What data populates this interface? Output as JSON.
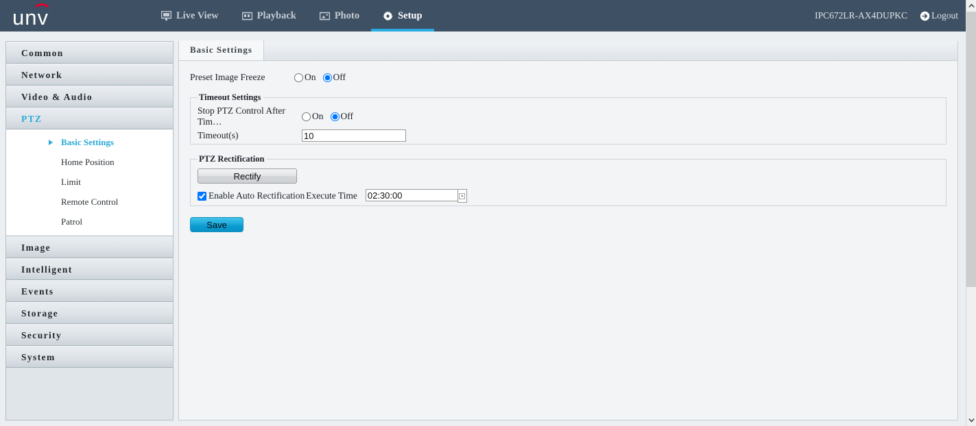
{
  "header": {
    "logo_text": "unv",
    "logo_arc_color": "#e4002b",
    "background_color": "#3e5063",
    "accent_color": "#29abe2",
    "nav": [
      {
        "label": "Live View",
        "icon": "monitor-icon",
        "active": false
      },
      {
        "label": "Playback",
        "icon": "film-icon",
        "active": false
      },
      {
        "label": "Photo",
        "icon": "image-icon",
        "active": false
      },
      {
        "label": "Setup",
        "icon": "gear-icon",
        "active": true
      }
    ],
    "device_name": "IPC672LR-AX4DUPKC",
    "logout_label": "Logout",
    "logout_icon": "logout-arrow-icon"
  },
  "sidebar": {
    "groups": [
      {
        "label": "Common",
        "active": false
      },
      {
        "label": "Network",
        "active": false
      },
      {
        "label": "Video & Audio",
        "active": false
      },
      {
        "label": "PTZ",
        "active": true
      },
      {
        "label": "Image",
        "active": false
      },
      {
        "label": "Intelligent",
        "active": false
      },
      {
        "label": "Events",
        "active": false
      },
      {
        "label": "Storage",
        "active": false
      },
      {
        "label": "Security",
        "active": false
      },
      {
        "label": "System",
        "active": false
      }
    ],
    "ptz_subitems": [
      {
        "label": "Basic Settings",
        "active": true
      },
      {
        "label": "Home Position",
        "active": false
      },
      {
        "label": "Limit",
        "active": false
      },
      {
        "label": "Remote Control",
        "active": false
      },
      {
        "label": "Patrol",
        "active": false
      }
    ],
    "active_group_color": "#2aa8d8"
  },
  "content": {
    "tab_label": "Basic Settings",
    "preset_image_freeze": {
      "label": "Preset Image Freeze",
      "on_label": "On",
      "off_label": "Off",
      "value": "Off"
    },
    "timeout_settings": {
      "legend": "Timeout Settings",
      "stop_ptz_label": "Stop PTZ Control After Tim…",
      "stop_ptz_on_label": "On",
      "stop_ptz_off_label": "Off",
      "stop_ptz_value": "Off",
      "timeout_label": "Timeout(s)",
      "timeout_value": "10"
    },
    "ptz_rectification": {
      "legend": "PTZ Rectification",
      "rectify_button_label": "Rectify",
      "enable_auto_label": "Enable Auto Rectification",
      "enable_auto_checked": true,
      "execute_time_label": "Execute Time",
      "execute_time_value": "02:30:00",
      "time_picker_icon": "clock-icon"
    },
    "save_button_label": "Save",
    "save_button_color": "#0c9cd0"
  },
  "scrollbar": {
    "up_icon": "chevron-up-icon",
    "down_icon": "chevron-down-icon"
  }
}
